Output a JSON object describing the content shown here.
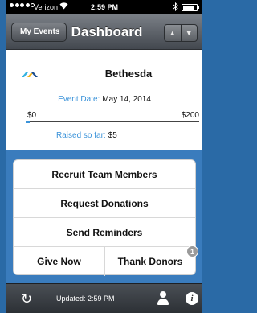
{
  "status_bar": {
    "carrier": "Verizon",
    "time": "2:59 PM",
    "wifi_icon": "wifi-icon",
    "bluetooth_icon": "bluetooth-icon"
  },
  "nav": {
    "back_label": "My Events",
    "title": "Dashboard",
    "prev_glyph": "▲",
    "next_glyph": "▼"
  },
  "event": {
    "name": "Bethesda",
    "date_label": "Event Date:",
    "date_value": "May 14, 2014",
    "goal_min": "$0",
    "goal_max": "$200",
    "progress": 0.025,
    "raised_label": "Raised so far:",
    "raised_value": "$5"
  },
  "actions": {
    "recruit": "Recruit Team Members",
    "request": "Request Donations",
    "reminders": "Send Reminders",
    "give_now": "Give Now",
    "thank_donors": "Thank Donors",
    "thank_badge": "1"
  },
  "footer": {
    "refresh_glyph": "↻",
    "updated": "Updated: 2:59 PM",
    "info_glyph": "i"
  },
  "colors": {
    "background": "#3a7cbd",
    "accent": "#3b93d9"
  }
}
